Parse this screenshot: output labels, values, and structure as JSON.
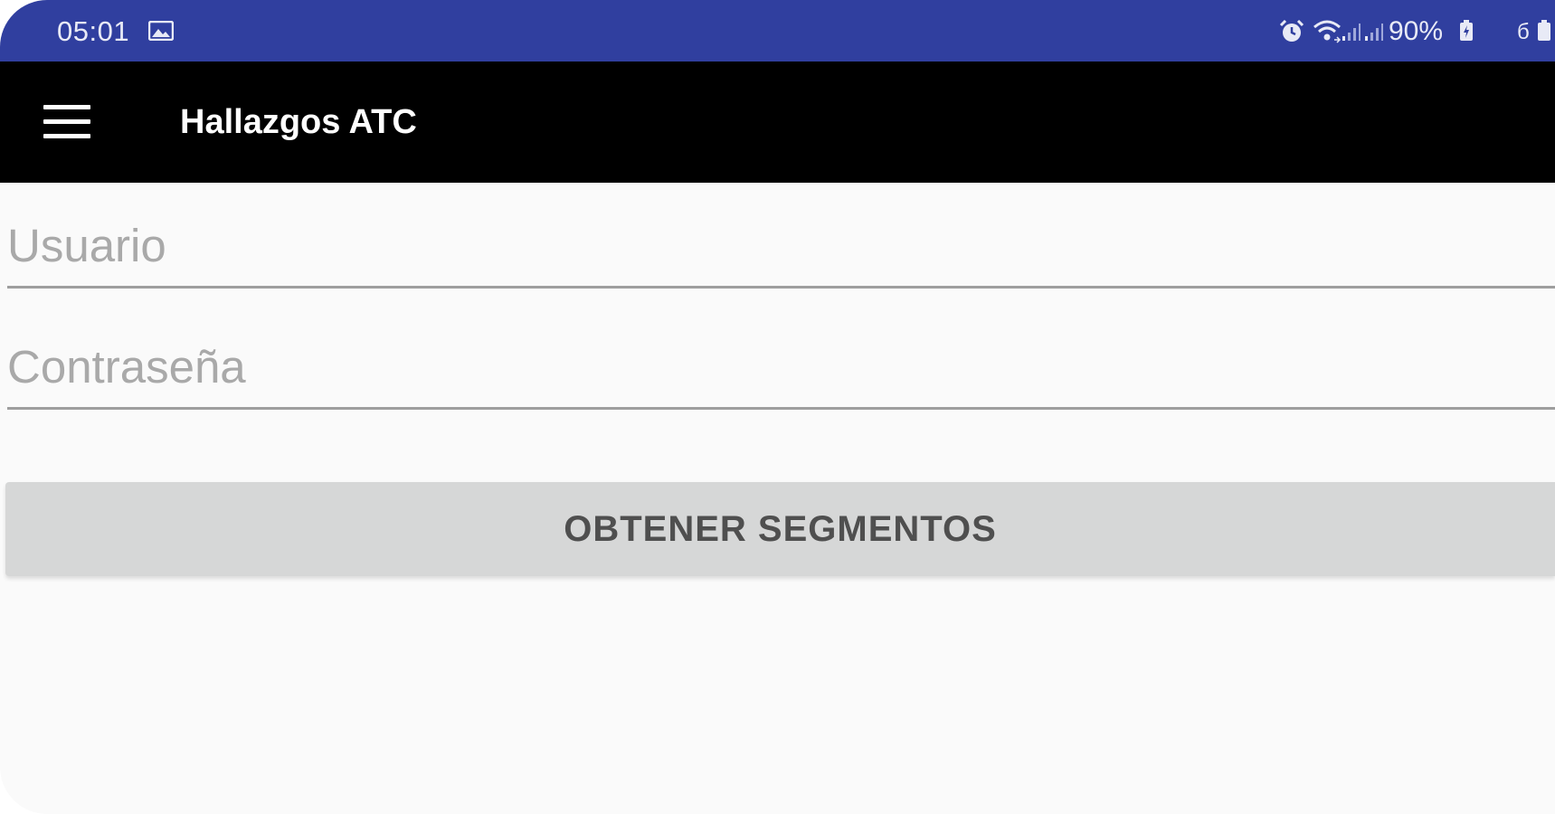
{
  "status_bar": {
    "time": "05:01",
    "battery_percent": "90%",
    "icons": [
      "gallery-icon",
      "alarm-icon",
      "wifi-icon",
      "signal-icon",
      "signal-icon",
      "battery-icon",
      "battery-icon"
    ],
    "background_color": "#303f9f"
  },
  "toolbar": {
    "title": "Hallazgos ATC",
    "menu_icon": "hamburger-menu-icon",
    "background_color": "#000000"
  },
  "form": {
    "username": {
      "placeholder": "Usuario",
      "value": ""
    },
    "password": {
      "placeholder": "Contraseña",
      "value": ""
    },
    "submit_label": "OBTENER SEGMENTOS"
  }
}
